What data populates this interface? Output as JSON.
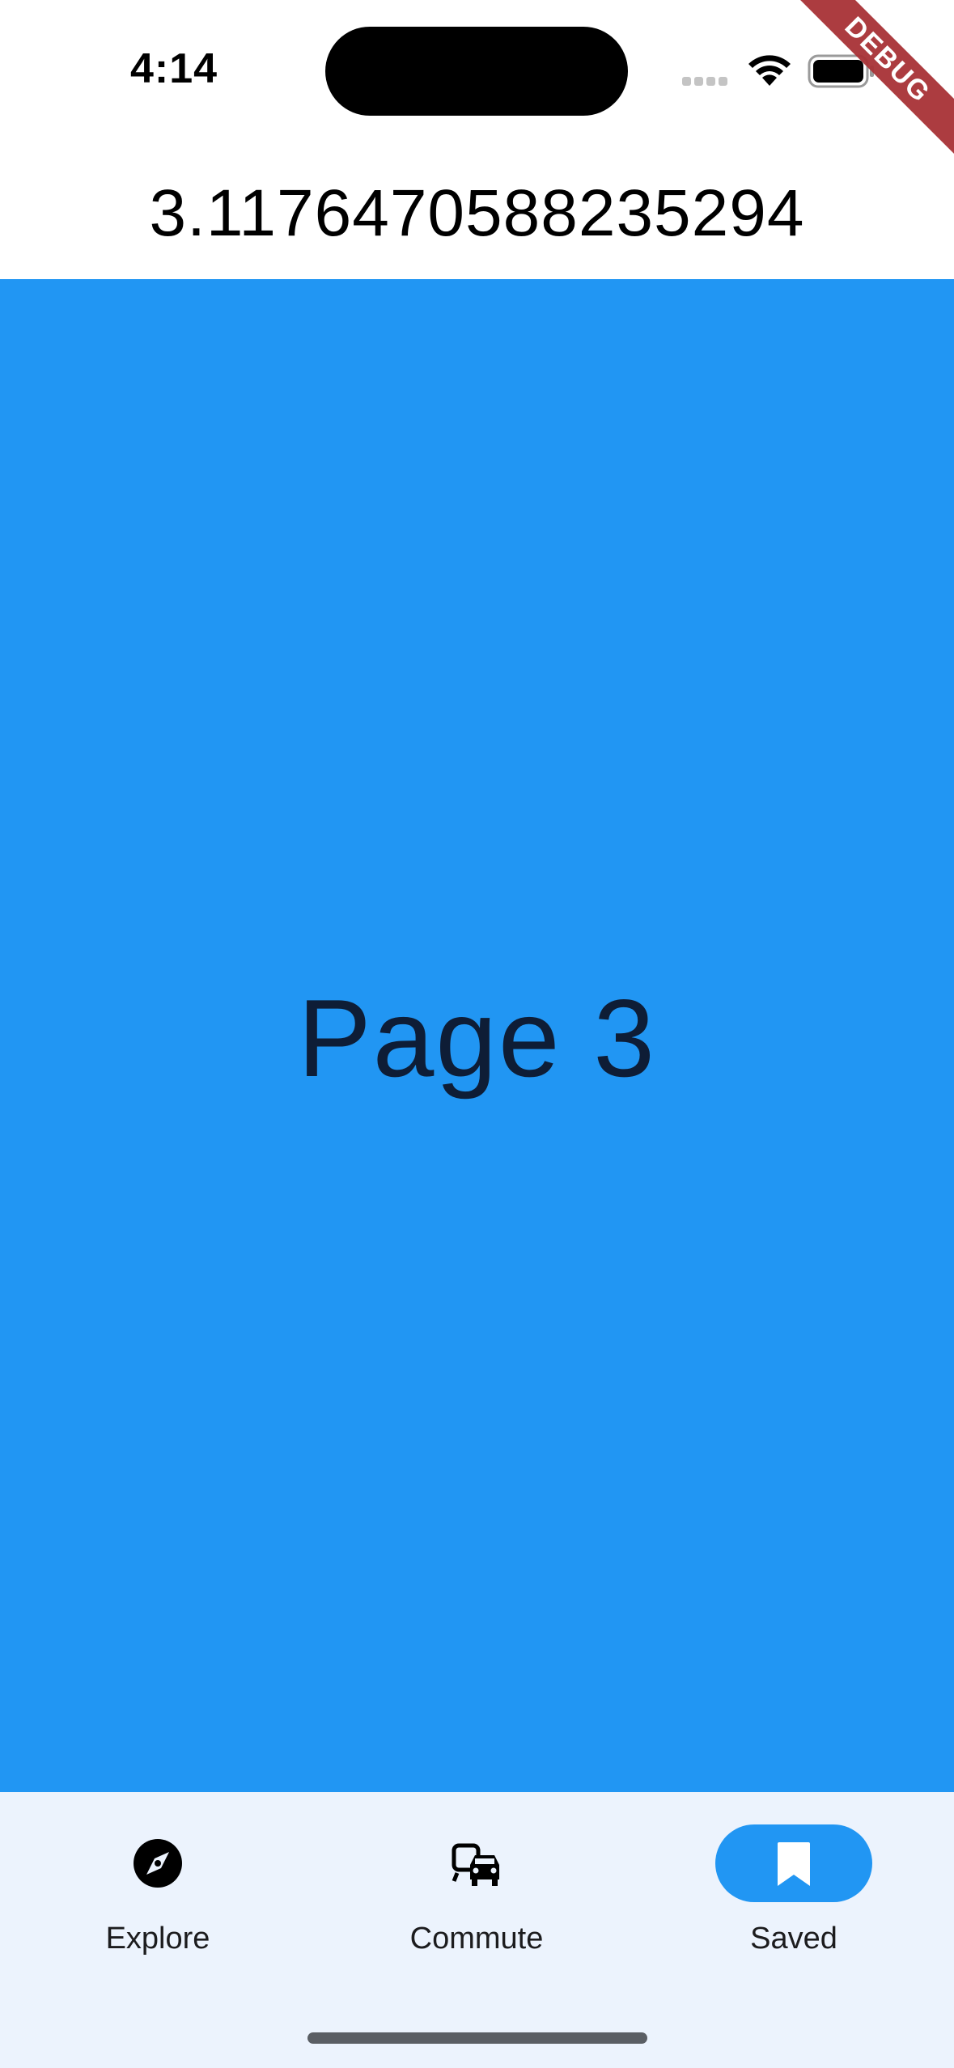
{
  "status_bar": {
    "time": "4:14"
  },
  "debug_banner": {
    "label": "DEBUG"
  },
  "header": {
    "value": "3.1176470588235294"
  },
  "page": {
    "label": "Page 3",
    "background": "#2196f3"
  },
  "bottom_nav": {
    "items": [
      {
        "label": "Explore",
        "icon": "explore-compass-icon",
        "selected": false
      },
      {
        "label": "Commute",
        "icon": "commute-icon",
        "selected": false
      },
      {
        "label": "Saved",
        "icon": "bookmark-icon",
        "selected": true
      }
    ],
    "indicator_color": "#2196f3",
    "background": "#ecf3fd"
  }
}
